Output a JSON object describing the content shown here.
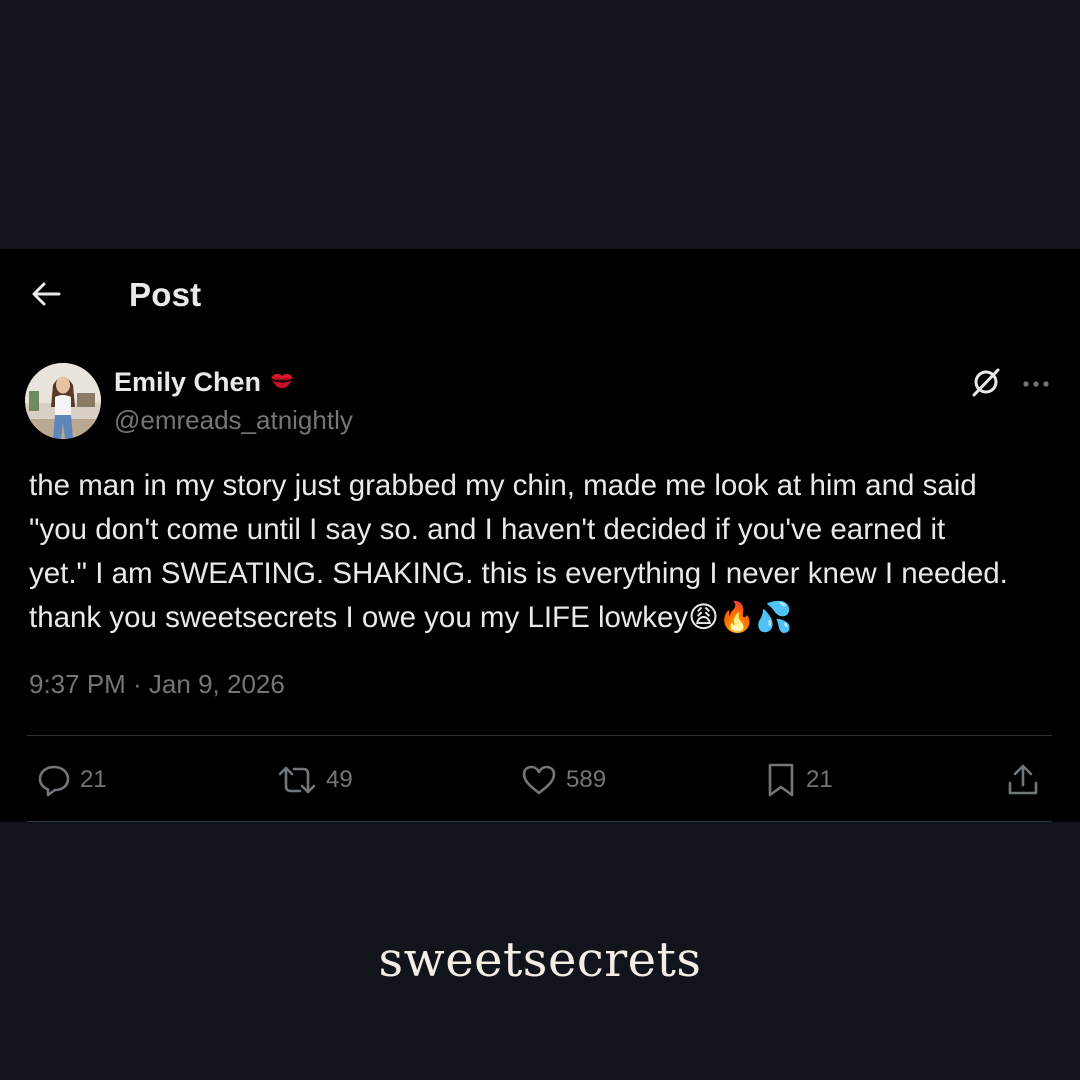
{
  "header": {
    "title": "Post",
    "back_icon": "arrow-left-icon"
  },
  "author": {
    "name": "Emily Chen",
    "badge_icon": "kiss-mark-emoji",
    "handle": "@emreads_atnightly"
  },
  "post": {
    "text": "the man in my story just grabbed my chin, made me look at him and said\n\"you don't come until I say so. and I haven't decided if you've earned it\nyet.\" I am SWEATING. SHAKING. this is everything I never knew I needed.\nthank you sweetsecrets I owe you my LIFE lowkey😩🔥💦",
    "timestamp": "9:37 PM · Jan 9, 2026"
  },
  "actions": {
    "replies": "21",
    "reposts": "49",
    "likes": "589",
    "bookmarks": "21"
  },
  "brand": {
    "wordmark": "sweetsecrets"
  },
  "colors": {
    "page_background": "#11141b",
    "card_background": "#000000",
    "primary_text": "#e7e9ea",
    "secondary_text": "#71767b",
    "divider": "#2f3336",
    "brand_text": "#f4ede6"
  }
}
